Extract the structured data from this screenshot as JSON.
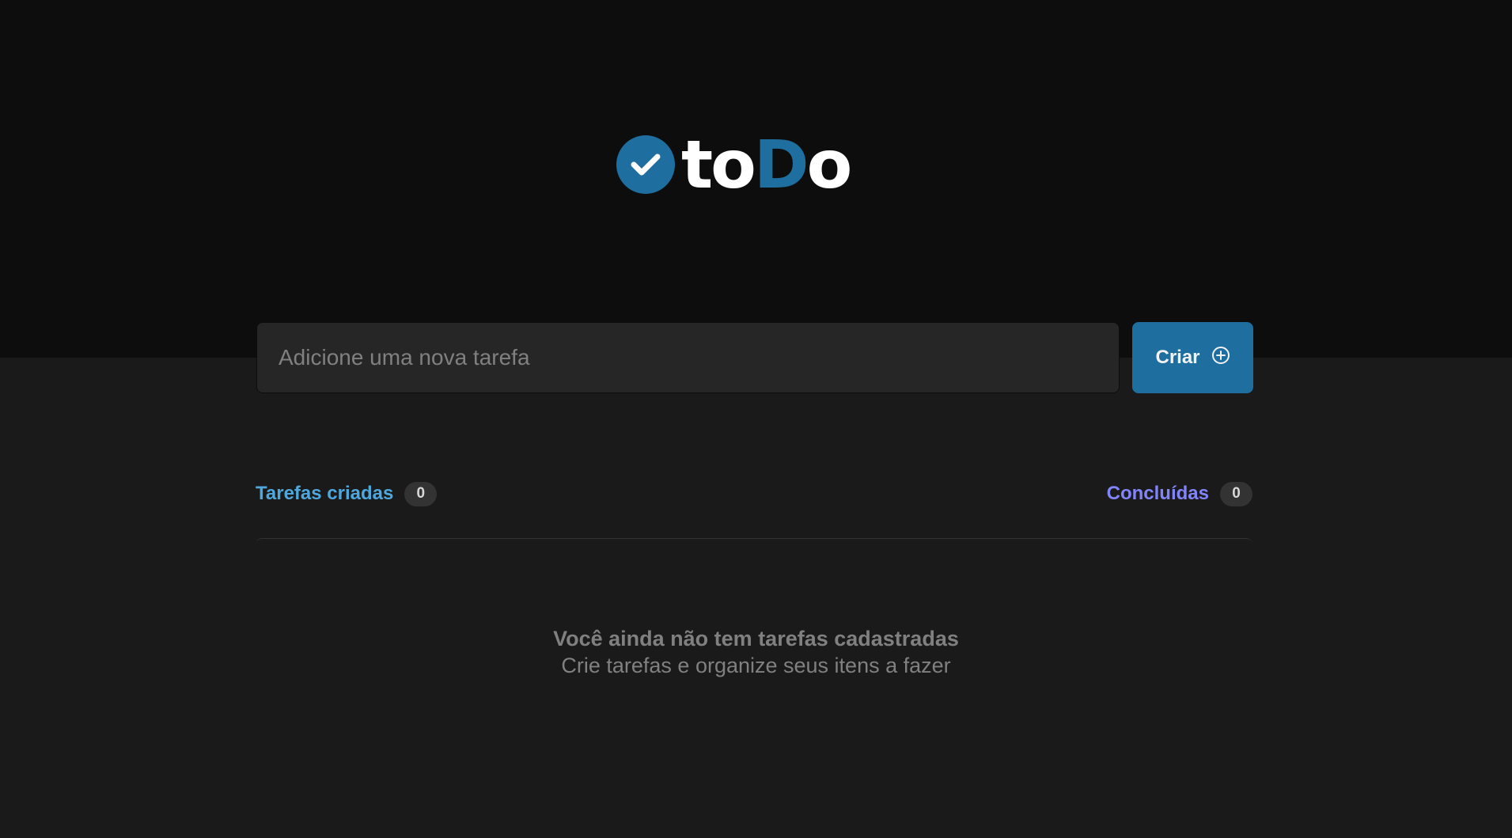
{
  "colors": {
    "header_bg": "#0d0d0d",
    "page_bg": "#1a1a1a",
    "blue": "#1e6f9f",
    "blue_light": "#4ea8de",
    "purple": "#8284fa",
    "white": "#f2f2f2"
  },
  "logo": {
    "icon": "check-circle-icon",
    "part1": "to",
    "part2": "D",
    "part3": "o"
  },
  "new_task": {
    "placeholder": "Adicione uma nova tarefa",
    "value": "",
    "create_label": "Criar",
    "create_icon": "plus-circle-icon"
  },
  "summary": {
    "created_label": "Tarefas criadas",
    "created_count": "0",
    "done_label": "Concluídas",
    "done_count": "0"
  },
  "empty_state": {
    "title": "Você ainda não tem tarefas cadastradas",
    "subtitle": "Crie tarefas e organize seus itens a fazer"
  }
}
